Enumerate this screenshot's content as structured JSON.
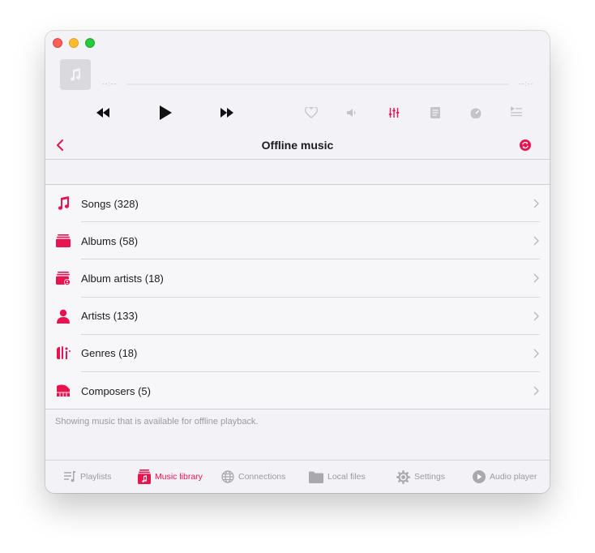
{
  "window": {
    "title": "Offline music"
  },
  "player": {
    "elapsed": "--:--",
    "remaining": "--:--"
  },
  "nav": {
    "title": "Offline music"
  },
  "list": {
    "items": [
      {
        "label": "Songs (328)",
        "icon": "music-note-icon"
      },
      {
        "label": "Albums (58)",
        "icon": "albums-icon"
      },
      {
        "label": "Album artists (18)",
        "icon": "album-artists-icon"
      },
      {
        "label": "Artists (133)",
        "icon": "artist-person-icon"
      },
      {
        "label": "Genres (18)",
        "icon": "genres-guitars-icon"
      },
      {
        "label": "Composers (5)",
        "icon": "piano-icon"
      }
    ],
    "footer": "Showing music that is available for offline playback."
  },
  "tabs": [
    {
      "label": "Playlists",
      "icon": "playlist-icon",
      "active": false
    },
    {
      "label": "Music library",
      "icon": "music-library-icon",
      "active": true
    },
    {
      "label": "Connections",
      "icon": "globe-icon",
      "active": false
    },
    {
      "label": "Local files",
      "icon": "folder-icon",
      "active": false
    },
    {
      "label": "Settings",
      "icon": "gear-icon",
      "active": false
    },
    {
      "label": "Audio player",
      "icon": "play-circle-icon",
      "active": false
    }
  ],
  "colors": {
    "accent": "#e8144f",
    "inactive": "#9a9aa0",
    "background": "#f2f2f7"
  }
}
